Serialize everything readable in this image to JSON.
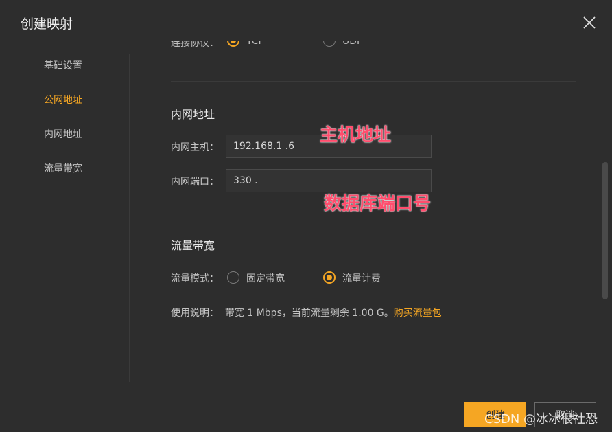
{
  "dialog": {
    "title": "创建映射"
  },
  "sidebar": {
    "items": [
      {
        "label": "基础设置"
      },
      {
        "label": "公网地址"
      },
      {
        "label": "内网地址"
      },
      {
        "label": "流量带宽"
      }
    ],
    "active_index": 1
  },
  "partial_row": {
    "label": "连接协议：",
    "option1": "TCP",
    "option2": "UDP"
  },
  "intranet": {
    "section_title": "内网地址",
    "host_label": "内网主机：",
    "host_value": "192.168.1  .6",
    "port_label": "内网端口：",
    "port_value": "330 ."
  },
  "bandwidth": {
    "section_title": "流量带宽",
    "mode_label": "流量模式：",
    "option_fixed": "固定带宽",
    "option_traffic": "流量计费",
    "selected": "流量计费",
    "usage_label": "使用说明：",
    "usage_text": "带宽 1 Mbps，当前流量剩余 1.00 G。",
    "usage_link": "购买流量包"
  },
  "annotations": {
    "host": "主机地址",
    "port": "数据库端口号"
  },
  "footer": {
    "create_label": "创建",
    "cancel_label": "取消"
  },
  "watermark": "CSDN @冰冰很社恐",
  "colors": {
    "accent": "#f5a623",
    "background": "#2d2d2d",
    "annotation": "#ff4d6d"
  }
}
